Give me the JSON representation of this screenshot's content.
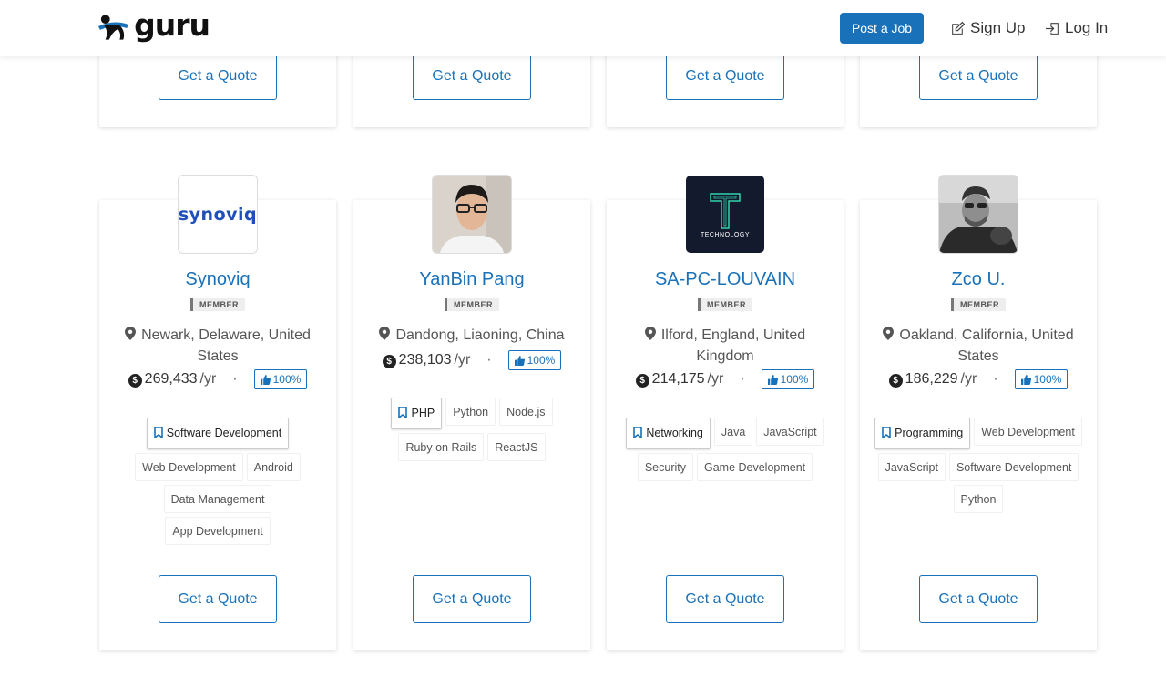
{
  "header": {
    "logo": "guru",
    "post_job": "Post a Job",
    "sign_up": "Sign Up",
    "log_in": "Log In"
  },
  "quote_label": "Get a Quote",
  "member_label": "MEMBER",
  "colors": {
    "brand_blue": "#1971b9"
  },
  "freelancers": [
    {
      "name": "Synoviq",
      "avatar_text": "synoviq",
      "location": "Newark, Delaware, United States",
      "earnings": "269,433",
      "period": "/yr",
      "rating": "100%",
      "skills": [
        "Software Development",
        "Web Development",
        "Android",
        "Data Management",
        "App Development"
      ]
    },
    {
      "name": "YanBin Pang",
      "avatar_text": "",
      "location": "Dandong, Liaoning, China",
      "earnings": "238,103",
      "period": "/yr",
      "rating": "100%",
      "skills": [
        "PHP",
        "Python",
        "Node.js",
        "Ruby on Rails",
        "ReactJS"
      ]
    },
    {
      "name": "SA-PC-LOUVAIN",
      "avatar_text": "TECHNOLOGY",
      "location": "Ilford, England, United Kingdom",
      "earnings": "214,175",
      "period": "/yr",
      "rating": "100%",
      "skills": [
        "Networking",
        "Java",
        "JavaScript",
        "Security",
        "Game Development"
      ]
    },
    {
      "name": "Zco U.",
      "avatar_text": "",
      "location": "Oakland, California, United States",
      "earnings": "186,229",
      "period": "/yr",
      "rating": "100%",
      "skills": [
        "Programming",
        "Web Development",
        "JavaScript",
        "Software Development",
        "Python"
      ]
    }
  ]
}
